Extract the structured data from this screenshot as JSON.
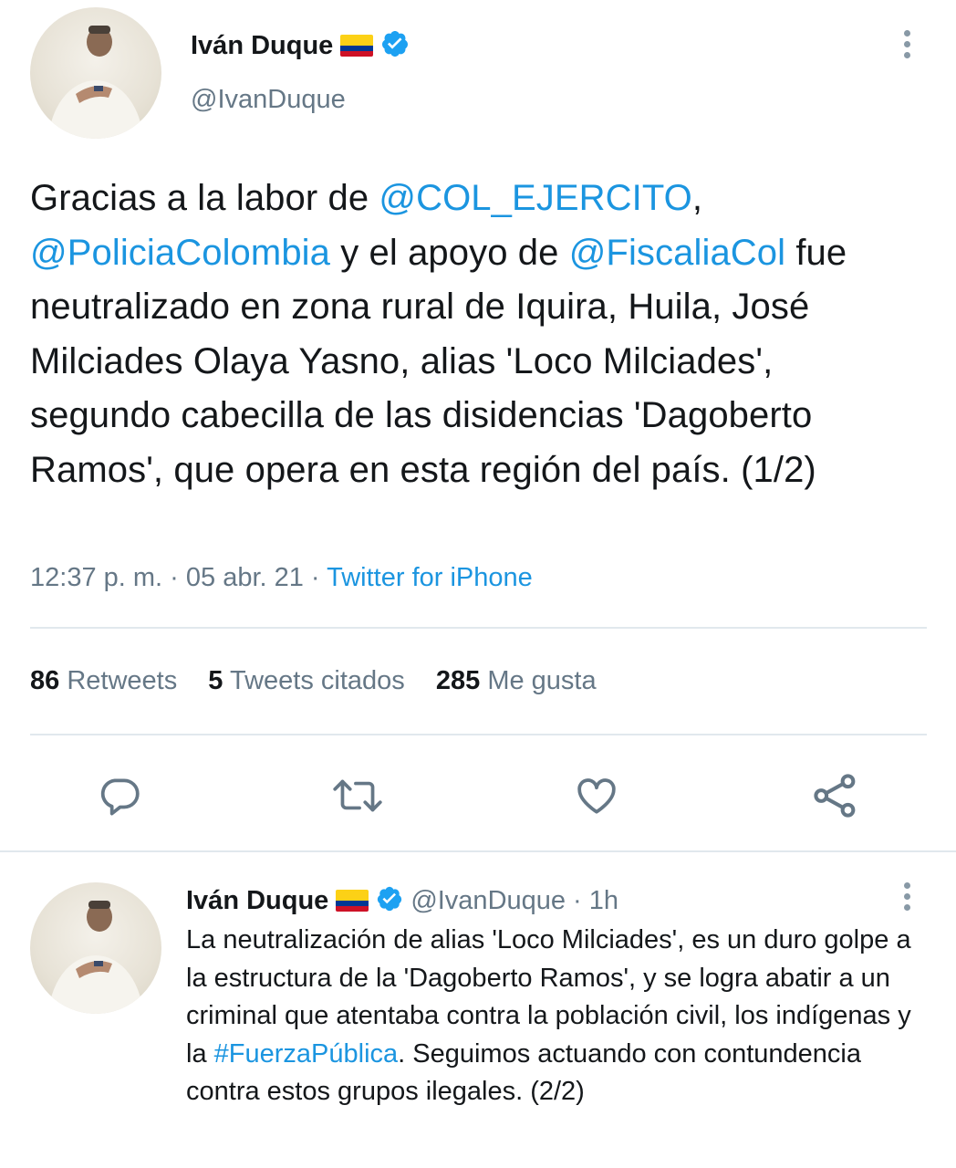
{
  "tweet": {
    "author_name": "Iván Duque",
    "handle": "@IvanDuque",
    "text_parts": [
      {
        "t": "Gracias a la labor de ",
        "link": false
      },
      {
        "t": "@COL_EJERCITO",
        "link": true
      },
      {
        "t": ", ",
        "link": false
      },
      {
        "t": "@PoliciaColombia",
        "link": true
      },
      {
        "t": " y el apoyo de ",
        "link": false
      },
      {
        "t": "@FiscaliaCol",
        "link": true
      },
      {
        "t": " fue neutralizado en zona rural de Iquira, Huila, José Milciades Olaya Yasno, alias 'Loco Milciades', segundo cabecilla de las disidencias 'Dagoberto Ramos', que opera en esta región del país. (1/2)",
        "link": false
      }
    ],
    "time": "12:37 p. m.",
    "date": "05 abr. 21",
    "source": "Twitter for iPhone",
    "retweets_count": "86",
    "retweets_label": "Retweets",
    "quotes_count": "5",
    "quotes_label": "Tweets citados",
    "likes_count": "285",
    "likes_label": "Me gusta"
  },
  "reply": {
    "author_name": "Iván Duque",
    "handle": "@IvanDuque",
    "age": "1h",
    "text_parts": [
      {
        "t": "La neutralización de alias 'Loco Milciades', es un duro golpe a la estructura de la 'Dagoberto Ramos', y se logra abatir a un criminal que atentaba contra la población civil, los indígenas y la ",
        "link": false
      },
      {
        "t": "#FuerzaPública",
        "link": true
      },
      {
        "t": ". Seguimos actuando con contundencia contra estos grupos ilegales. (2/2)",
        "link": false
      }
    ]
  },
  "icons": {
    "verified": "verified-badge-icon",
    "flag": "colombia-flag-icon",
    "more": "more-vertical-icon",
    "reply": "reply-icon",
    "retweet": "retweet-icon",
    "like": "heart-icon",
    "share": "share-icon"
  },
  "colors": {
    "link": "#1b95e0",
    "muted": "#657786",
    "text": "#14171a",
    "divider": "#e1e8ed"
  }
}
